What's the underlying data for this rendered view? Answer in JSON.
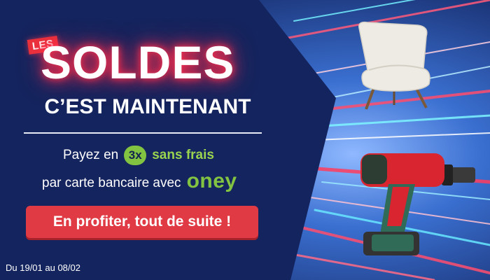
{
  "promo": {
    "tag": "LES",
    "title": "SOLDES",
    "subtitle": "C’EST MAINTENANT",
    "pay_prefix": "Payez en",
    "installments": "3x",
    "no_fees": "sans frais",
    "card_text": "par carte bancaire avec",
    "partner_logo": "oney",
    "cta_label": "En profiter, tout de suite !",
    "dates": "Du 19/01 au 08/02"
  },
  "colors": {
    "navy": "#14245e",
    "accent_red": "#e03a44",
    "oney_green": "#82c341"
  },
  "icons": {
    "chair": "armchair-icon",
    "drill": "cordless-drill-icon"
  }
}
